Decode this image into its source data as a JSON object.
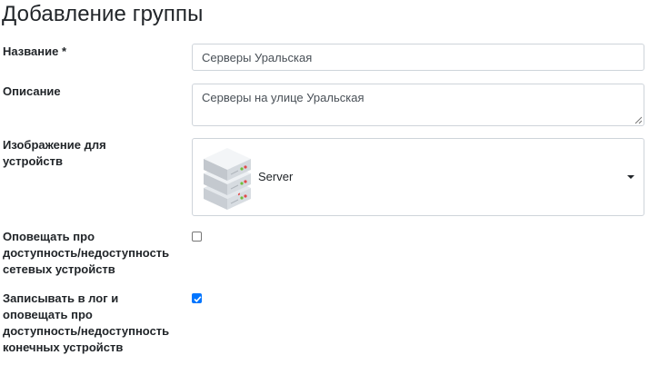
{
  "page": {
    "title": "Добавление группы"
  },
  "form": {
    "name_label": "Название *",
    "name_value": "Серверы Уральская",
    "description_label": "Описание",
    "description_value": "Серверы на улице Уральская",
    "image_label_line1": "Изображение для",
    "image_label_line2": "устройств",
    "image_selected": "Server",
    "notify_network_label_line1": "Оповещать про",
    "notify_network_label_line2": "доступность/недоступность",
    "notify_network_label_line3": "сетевых устройств",
    "notify_network_checked": false,
    "log_endpoint_label_line1": "Записывать в лог и",
    "log_endpoint_label_line2": "оповещать про",
    "log_endpoint_label_line3": "доступность/недоступность",
    "log_endpoint_label_line4": "конечных устройств",
    "log_endpoint_checked": true
  },
  "icons": {
    "image_preview": "server-rack-icon",
    "dropdown": "caret-down-icon",
    "checkmark": "check-icon"
  },
  "colors": {
    "checkbox_checked": "#0075ff",
    "input_border": "#ced4da"
  }
}
